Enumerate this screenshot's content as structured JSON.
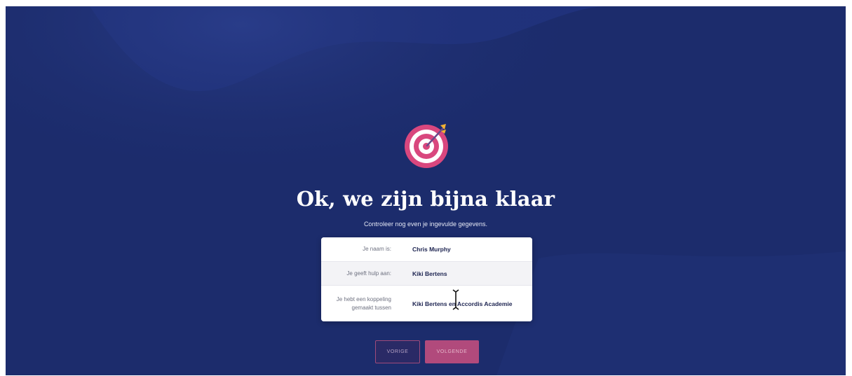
{
  "header": {
    "icon": "target-icon",
    "title": "Ok, we zijn bijna klaar",
    "subtitle": "Controleer nog even je ingevulde gegevens."
  },
  "summary": {
    "rows": [
      {
        "label": "Je naam is:",
        "value": "Chris Murphy"
      },
      {
        "label": "Je geeft hulp aan:",
        "value": "Kiki Bertens"
      },
      {
        "label": "Je hebt een koppeling gemaakt tussen",
        "value": "Kiki Bertens en Accordis Academie"
      }
    ]
  },
  "buttons": {
    "prev_label": "VORIGE",
    "next_label": "VOLGENDE"
  },
  "colors": {
    "background": "#1b2b6b",
    "accent": "#b14a7c",
    "card": "#ffffff"
  }
}
